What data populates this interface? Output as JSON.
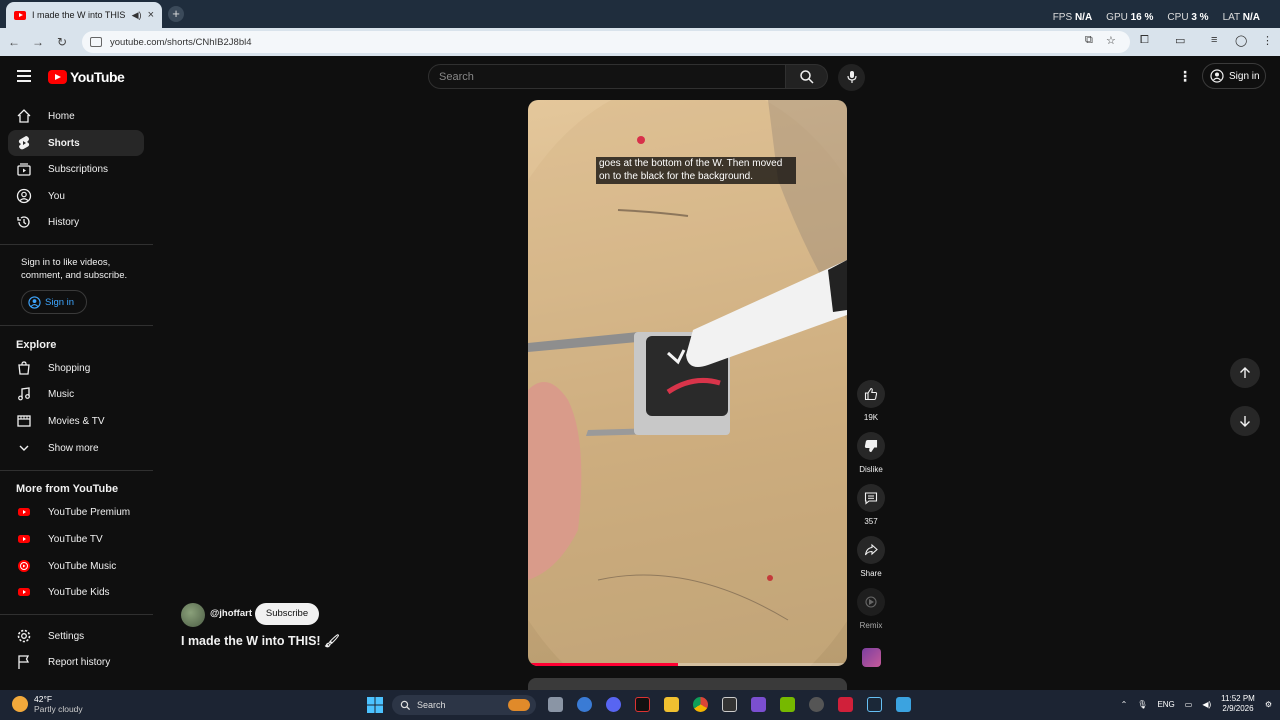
{
  "browser": {
    "tab_title": "I made the W into THIS! 🖌",
    "tab_close": "×",
    "new_tab": "+",
    "url": "youtube.com/shorts/CNhIB2J8bl4",
    "perf": {
      "fps_label": "FPS",
      "fps_value": "N/A",
      "gpu_label": "GPU",
      "gpu_value": "16 %",
      "cpu_label": "CPU",
      "cpu_value": "3 %",
      "lat_label": "LAT",
      "lat_value": "N/A"
    }
  },
  "header": {
    "logo_text": "YouTube",
    "search_placeholder": "Search",
    "sign_in": "Sign in"
  },
  "sidebar": {
    "main": [
      {
        "label": "Home",
        "icon": "home-icon"
      },
      {
        "label": "Shorts",
        "icon": "shorts-icon"
      },
      {
        "label": "Subscriptions",
        "icon": "subscriptions-icon"
      },
      {
        "label": "You",
        "icon": "you-icon"
      },
      {
        "label": "History",
        "icon": "history-icon"
      }
    ],
    "signin_message": "Sign in to like videos, comment, and subscribe.",
    "signin_button": "Sign in",
    "explore_heading": "Explore",
    "explore": [
      {
        "label": "Shopping",
        "icon": "shopping-icon"
      },
      {
        "label": "Music",
        "icon": "music-icon"
      },
      {
        "label": "Movies & TV",
        "icon": "movies-icon"
      },
      {
        "label": "Show more",
        "icon": "chevron-down-icon"
      }
    ],
    "more_heading": "More from YouTube",
    "more": [
      {
        "label": "YouTube Premium"
      },
      {
        "label": "YouTube TV"
      },
      {
        "label": "YouTube Music"
      },
      {
        "label": "YouTube Kids"
      }
    ],
    "footer": [
      {
        "label": "Settings",
        "icon": "gear-icon"
      },
      {
        "label": "Report history",
        "icon": "flag-icon"
      }
    ],
    "accent_color": "#ff0000"
  },
  "video": {
    "caption": "goes at the bottom of the W. Then moved on to the black for the background.",
    "progress": 0.47,
    "progress_color": "#ff0033"
  },
  "actions": {
    "likes": "19K",
    "dislike": "Dislike",
    "comments": "357",
    "share": "Share",
    "remix": "Remix"
  },
  "channel": {
    "handle": "@jhoffart",
    "subscribe": "Subscribe",
    "title": "I made the W into THIS! 🖌"
  },
  "taskbar": {
    "temp": "42°F",
    "weather": "Partly cloudy",
    "search": "Search",
    "lang": "ENG",
    "time": "11:52 PM",
    "date": "2/9/2026"
  }
}
